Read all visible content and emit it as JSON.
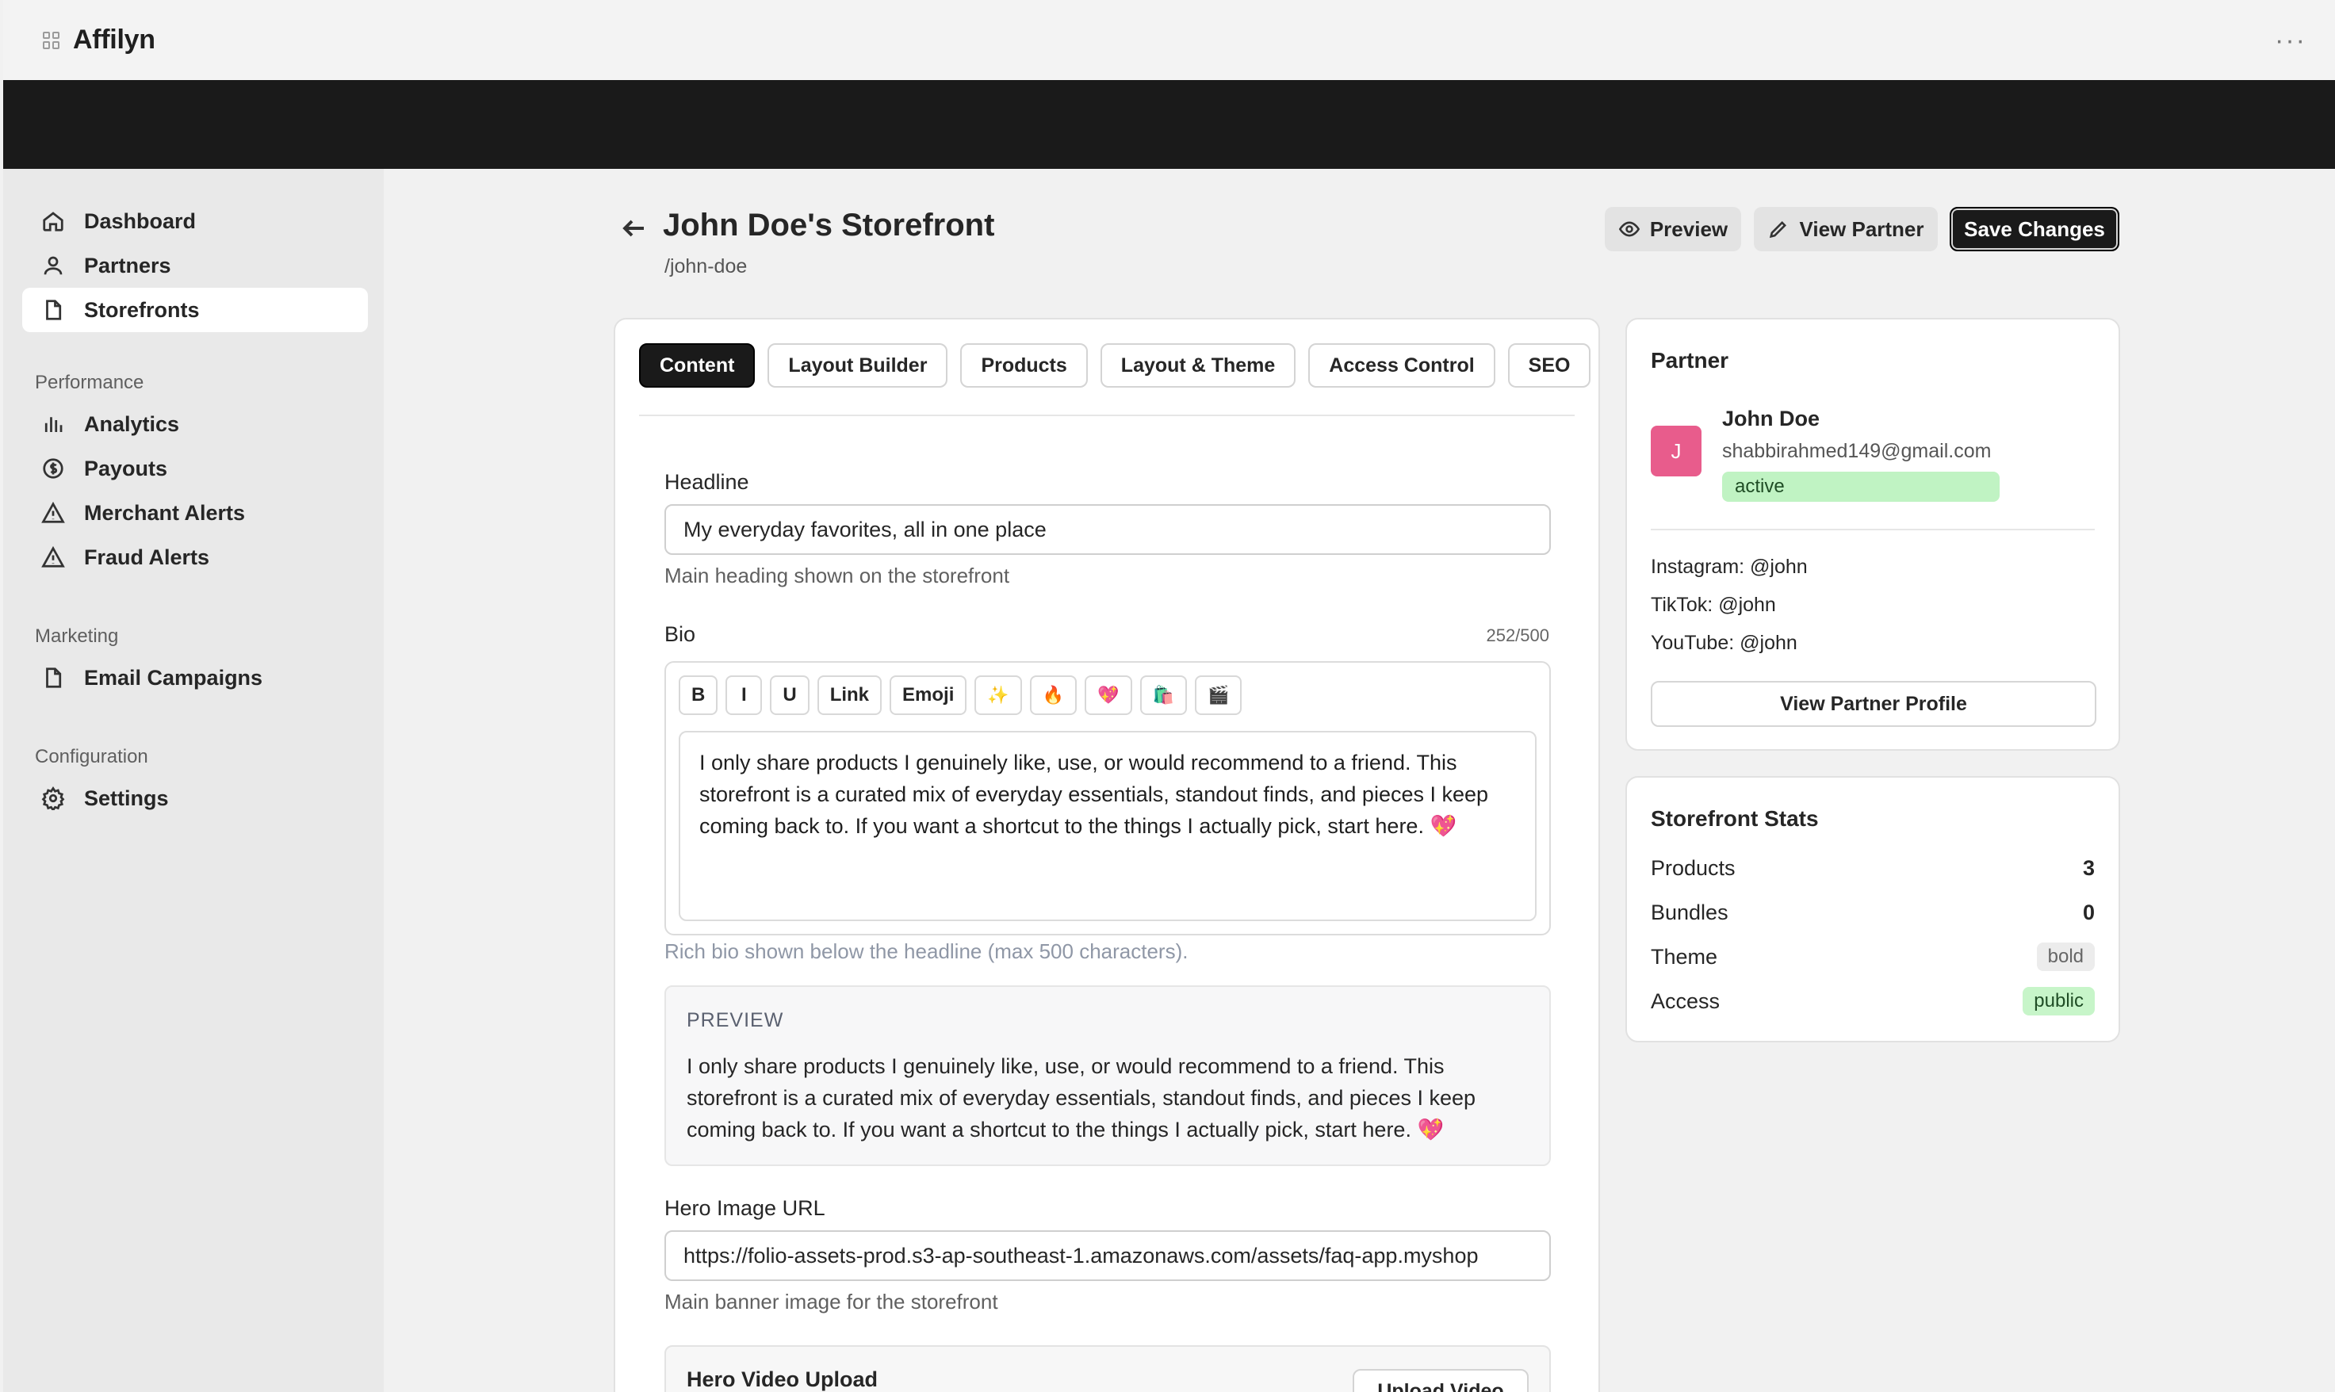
{
  "app": {
    "name": "Affilyn"
  },
  "sidebar": {
    "items": [
      {
        "label": "Dashboard",
        "icon": "home-icon"
      },
      {
        "label": "Partners",
        "icon": "user-icon"
      },
      {
        "label": "Storefronts",
        "icon": "file-icon"
      }
    ],
    "sections": [
      {
        "label": "Performance",
        "items": [
          {
            "label": "Analytics",
            "icon": "bar-chart-icon"
          },
          {
            "label": "Payouts",
            "icon": "dollar-icon"
          },
          {
            "label": "Merchant Alerts",
            "icon": "warning-icon"
          },
          {
            "label": "Fraud Alerts",
            "icon": "warning-icon"
          }
        ]
      },
      {
        "label": "Marketing",
        "items": [
          {
            "label": "Email Campaigns",
            "icon": "file-icon"
          }
        ]
      },
      {
        "label": "Configuration",
        "items": [
          {
            "label": "Settings",
            "icon": "gear-icon"
          }
        ]
      }
    ]
  },
  "header": {
    "title": "John Doe's Storefront",
    "slug": "/john-doe",
    "preview_label": "Preview",
    "view_partner_label": "View Partner",
    "save_label": "Save Changes"
  },
  "tabs": [
    "Content",
    "Layout Builder",
    "Products",
    "Layout & Theme",
    "Access Control",
    "SEO"
  ],
  "content": {
    "headline_label": "Headline",
    "headline_value": "My everyday favorites, all in one place",
    "headline_help": "Main heading shown on the storefront",
    "bio_label": "Bio",
    "bio_counter": "252/500",
    "toolbar": [
      "B",
      "I",
      "U",
      "Link",
      "Emoji",
      "✨",
      "🔥",
      "💖",
      "🛍️",
      "🎬"
    ],
    "bio_text": "I only share products I genuinely like, use, or would recommend to a friend. This storefront is a curated mix of everyday essentials, standout finds, and pieces I keep coming back to. If you want a shortcut to the things I actually pick, start here. 💖",
    "bio_help": "Rich bio shown below the headline (max 500 characters).",
    "preview_label": "PREVIEW",
    "preview_text": "I only share products I genuinely like, use, or would recommend to a friend. This storefront is a curated mix of everyday essentials, standout finds, and pieces I keep coming back to. If you want a shortcut to the things I actually pick, start here. 💖",
    "hero_label": "Hero Image URL",
    "hero_value": "https://folio-assets-prod.s3-ap-southeast-1.amazonaws.com/assets/faq-app.myshop",
    "hero_help": "Main banner image for the storefront",
    "video_title": "Hero Video Upload",
    "upload_label": "Upload Video"
  },
  "partner": {
    "title": "Partner",
    "avatar_letter": "J",
    "name": "John Doe",
    "email": "shabbirahmed149@gmail.com",
    "status": "active",
    "instagram": "Instagram: @john",
    "tiktok": "TikTok: @john",
    "youtube": "YouTube: @john",
    "profile_button": "View Partner Profile"
  },
  "stats": {
    "title": "Storefront Stats",
    "products_label": "Products",
    "products_value": "3",
    "bundles_label": "Bundles",
    "bundles_value": "0",
    "theme_label": "Theme",
    "theme_value": "bold",
    "access_label": "Access",
    "access_value": "public"
  },
  "colors": {
    "accent": "#1a1a1a",
    "active_green": "#c0f3c3",
    "avatar_pink": "#e85c8c"
  }
}
